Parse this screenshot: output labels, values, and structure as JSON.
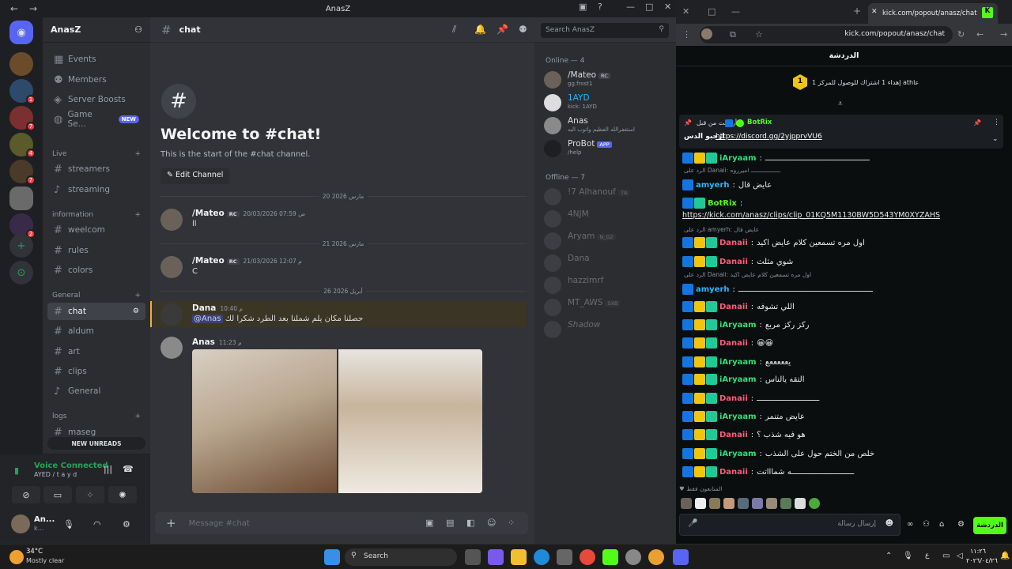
{
  "discord": {
    "window_title": "AnasZ",
    "server_name": "AnasZ",
    "channel_name": "chat",
    "search_placeholder": "Search AnasZ",
    "sidebar_top": [
      {
        "icon": "calendar-icon",
        "label": "Events"
      },
      {
        "icon": "members-icon",
        "label": "Members"
      },
      {
        "icon": "boost-icon",
        "label": "Server Boosts"
      },
      {
        "icon": "game-icon",
        "label": "Game Se...",
        "badge": "NEW"
      }
    ],
    "categories": [
      {
        "name": "Live",
        "channels": [
          {
            "type": "text",
            "label": "streamers"
          },
          {
            "type": "voice",
            "label": "streaming"
          }
        ]
      },
      {
        "name": "information",
        "channels": [
          {
            "type": "text",
            "label": "weelcom"
          },
          {
            "type": "text",
            "label": "rules"
          },
          {
            "type": "text",
            "label": "colors"
          }
        ]
      },
      {
        "name": "General",
        "channels": [
          {
            "type": "text",
            "label": "chat",
            "active": true
          },
          {
            "type": "text",
            "label": "aldum"
          },
          {
            "type": "text",
            "label": "art"
          },
          {
            "type": "text",
            "label": "clips"
          },
          {
            "type": "voice",
            "label": "General"
          }
        ]
      },
      {
        "name": "logs",
        "channels": [
          {
            "type": "text",
            "label": "maseg"
          }
        ]
      }
    ],
    "new_unreads": "NEW UNREADS",
    "voice": {
      "status": "Voice Connected",
      "sub": "AYED / t a y d"
    },
    "user": {
      "name": "An...",
      "status": "k..."
    },
    "welcome": {
      "title": "Welcome to #chat!",
      "subtitle": "This is the start of the #chat channel.",
      "edit_button": "Edit Channel"
    },
    "dividers": [
      "20 مارس 2026",
      "21 مارس 2026",
      "26 أبريل 2026"
    ],
    "messages": [
      {
        "author": "/Mateo",
        "tag": "RC",
        "time": "20/03/2026 07:59 ص",
        "text": "ll"
      },
      {
        "author": "/Mateo",
        "tag": "RC",
        "time": "21/03/2026 12:07 م",
        "text": "C"
      },
      {
        "author": "Dana",
        "time": "10:40 م",
        "mention": "@Anas",
        "text": "حصلنا مكان يلم شملنا بعد الطرد شكرا لك"
      },
      {
        "author": "Anas",
        "time": "11:23 م",
        "text": ""
      }
    ],
    "composer_placeholder": "Message #chat",
    "members_online_header": "Online — 4",
    "members_online": [
      {
        "name": "/Mateo",
        "sub": "gg.frost1",
        "tag": "RC"
      },
      {
        "name": "1AYD",
        "sub": "kick: 1AYD"
      },
      {
        "name": "Anas",
        "sub": "استغفرالله العظيم واتوب اليه"
      },
      {
        "name": "ProBot",
        "sub": "/help",
        "tag": "APP"
      }
    ],
    "members_offline_header": "Offline — 7",
    "members_offline": [
      {
        "name": "!7 Alhanouf",
        "tag": "7A"
      },
      {
        "name": "4NJM"
      },
      {
        "name": "Aryam",
        "tag": "N_G2"
      },
      {
        "name": "Dana"
      },
      {
        "name": "hazzimrf"
      },
      {
        "name": "MT_AWS",
        "tag": "SXB"
      },
      {
        "name": "Shadow"
      }
    ]
  },
  "kick": {
    "tab_title": "kick.com/popout/anasz/chat",
    "url": "kick.com/popout/anasz/chat",
    "header": "الدردشة",
    "goal": "إهداء 1 اشتراك للوصول للمركز 1 athعا",
    "goal_rank": "1",
    "pinned_author": "BotRix",
    "pinned_label": "أرسلت من قبل",
    "pinned_link": "https://discord.gg/2yjpprvVU6",
    "pinned_text": "ارحبو الدس",
    "messages": [
      {
        "user": "iAryaam",
        "color": "#2ee07a",
        "badges": [
          "mod",
          "sub",
          "vip"
        ],
        "text": "ـــــــــــــــــــــــــــــــــــــــــــــ"
      },
      {
        "reply": "الرد على Danaii: ـــــــــــــــــ اميرروه"
      },
      {
        "user": "amyerh",
        "color": "#2bb5ff",
        "badges": [
          "mod"
        ],
        "text": "عايض قال"
      },
      {
        "user": "BotRix",
        "color": "#53fc18",
        "badges": [
          "mod",
          "vip"
        ],
        "text": ""
      },
      {
        "link": "https://kick.com/anasz/clips/clip_01KQ5M1130BW5D543YM0XYZAHS"
      },
      {
        "reply": "الرد على amyerh: عايض قال"
      },
      {
        "user": "Danaii",
        "color": "#ff5c7a",
        "badges": [
          "mod",
          "sub",
          "vip"
        ],
        "text": "اول مره تسمعين كلام عايض اكيد"
      },
      {
        "user": "Danaii",
        "color": "#ff5c7a",
        "badges": [
          "mod",
          "sub",
          "vip"
        ],
        "text": "شوي مثلث"
      },
      {
        "reply": "الرد على Danaii: اول مره تسمعين كلام عايض اكيد"
      },
      {
        "user": "amyerh",
        "color": "#2bb5ff",
        "badges": [
          "mod"
        ],
        "text": "ــــــــــــــــــــــــــــــــــــــــــــــــــــــــــ"
      },
      {
        "user": "Danaii",
        "color": "#ff5c7a",
        "badges": [
          "mod",
          "sub",
          "vip"
        ],
        "text": "اللي تشوفه"
      },
      {
        "user": "iAryaam",
        "color": "#2ee07a",
        "badges": [
          "mod",
          "sub",
          "vip"
        ],
        "text": "ركز ركز مربع"
      },
      {
        "user": "Danaii",
        "color": "#ff5c7a",
        "badges": [
          "mod",
          "sub",
          "vip"
        ],
        "text": "😀😀"
      },
      {
        "user": "iAryaam",
        "color": "#2ee07a",
        "badges": [
          "mod",
          "sub",
          "vip"
        ],
        "text": "يعععععع"
      },
      {
        "user": "iAryaam",
        "color": "#2ee07a",
        "badges": [
          "mod",
          "sub",
          "vip"
        ],
        "text": "التقه يالناس"
      },
      {
        "user": "Danaii",
        "color": "#ff5c7a",
        "badges": [
          "mod",
          "sub",
          "vip"
        ],
        "text": "ـــــــــــــــــــــــــــ"
      },
      {
        "user": "iAryaam",
        "color": "#2ee07a",
        "badges": [
          "mod",
          "sub",
          "vip"
        ],
        "text": "عايض متنمر"
      },
      {
        "user": "Danaii",
        "color": "#ff5c7a",
        "badges": [
          "mod",
          "sub",
          "vip"
        ],
        "text": "هو فيه شذب ؟"
      },
      {
        "user": "iAryaam",
        "color": "#2ee07a",
        "badges": [
          "mod",
          "sub",
          "vip"
        ],
        "text": "خلص من الختم حول على الشذب"
      },
      {
        "user": "Danaii",
        "color": "#ff5c7a",
        "badges": [
          "mod",
          "sub",
          "vip"
        ],
        "text": "ـــــــــــــــــــــــــــه شماااتت"
      }
    ],
    "viewers_label": "المتابعون فقط",
    "input_placeholder": "إرسال رسالة",
    "send_label": "الدردشة"
  },
  "taskbar": {
    "weather_temp": "34°C",
    "weather_desc": "Mostly clear",
    "search": "Search",
    "time": "١١:٢٦",
    "date": "٢٠٢٦/٠٤/٢٦"
  }
}
